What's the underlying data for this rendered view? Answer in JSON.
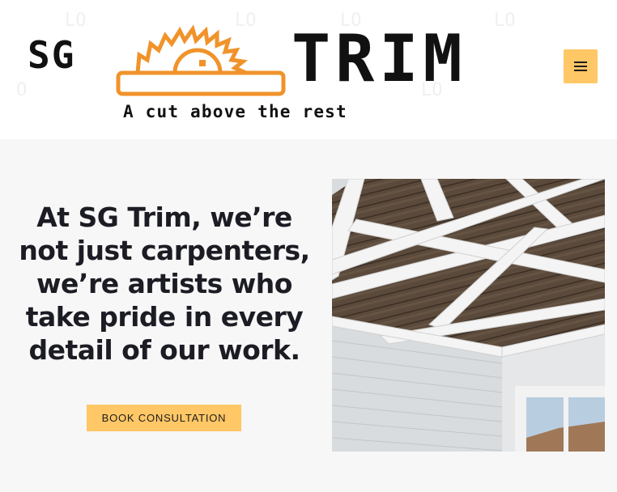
{
  "header": {
    "logo": {
      "left_text": "SG",
      "right_text": "TRIM",
      "tagline": "A cut above the rest",
      "brand_color": "#f0932b",
      "text_color": "#111111"
    },
    "menu_icon": "hamburger-menu-icon"
  },
  "hero": {
    "headline": "At SG Trim, we’re not just carpenters, we’re artists who take pride in every detail of our work.",
    "cta_label": "BOOK CONSULTATION",
    "image_subject": "coffered ceiling with dark wood panels and white beams"
  },
  "colors": {
    "accent": "#ffc766",
    "background": "#f7f7f7",
    "heading": "#1c1c24"
  }
}
